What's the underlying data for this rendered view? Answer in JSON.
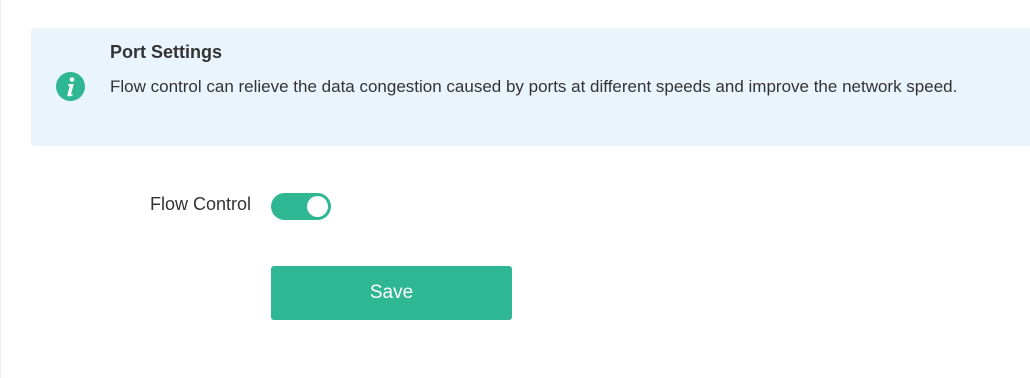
{
  "info": {
    "icon": "info-icon",
    "title": "Port Settings",
    "description": "Flow control can relieve the data congestion caused by ports at different speeds and improve the network speed."
  },
  "flow_control": {
    "label": "Flow Control",
    "enabled": true
  },
  "actions": {
    "save_label": "Save"
  },
  "colors": {
    "accent": "#2fb793",
    "info_background": "#eaf4fc"
  }
}
